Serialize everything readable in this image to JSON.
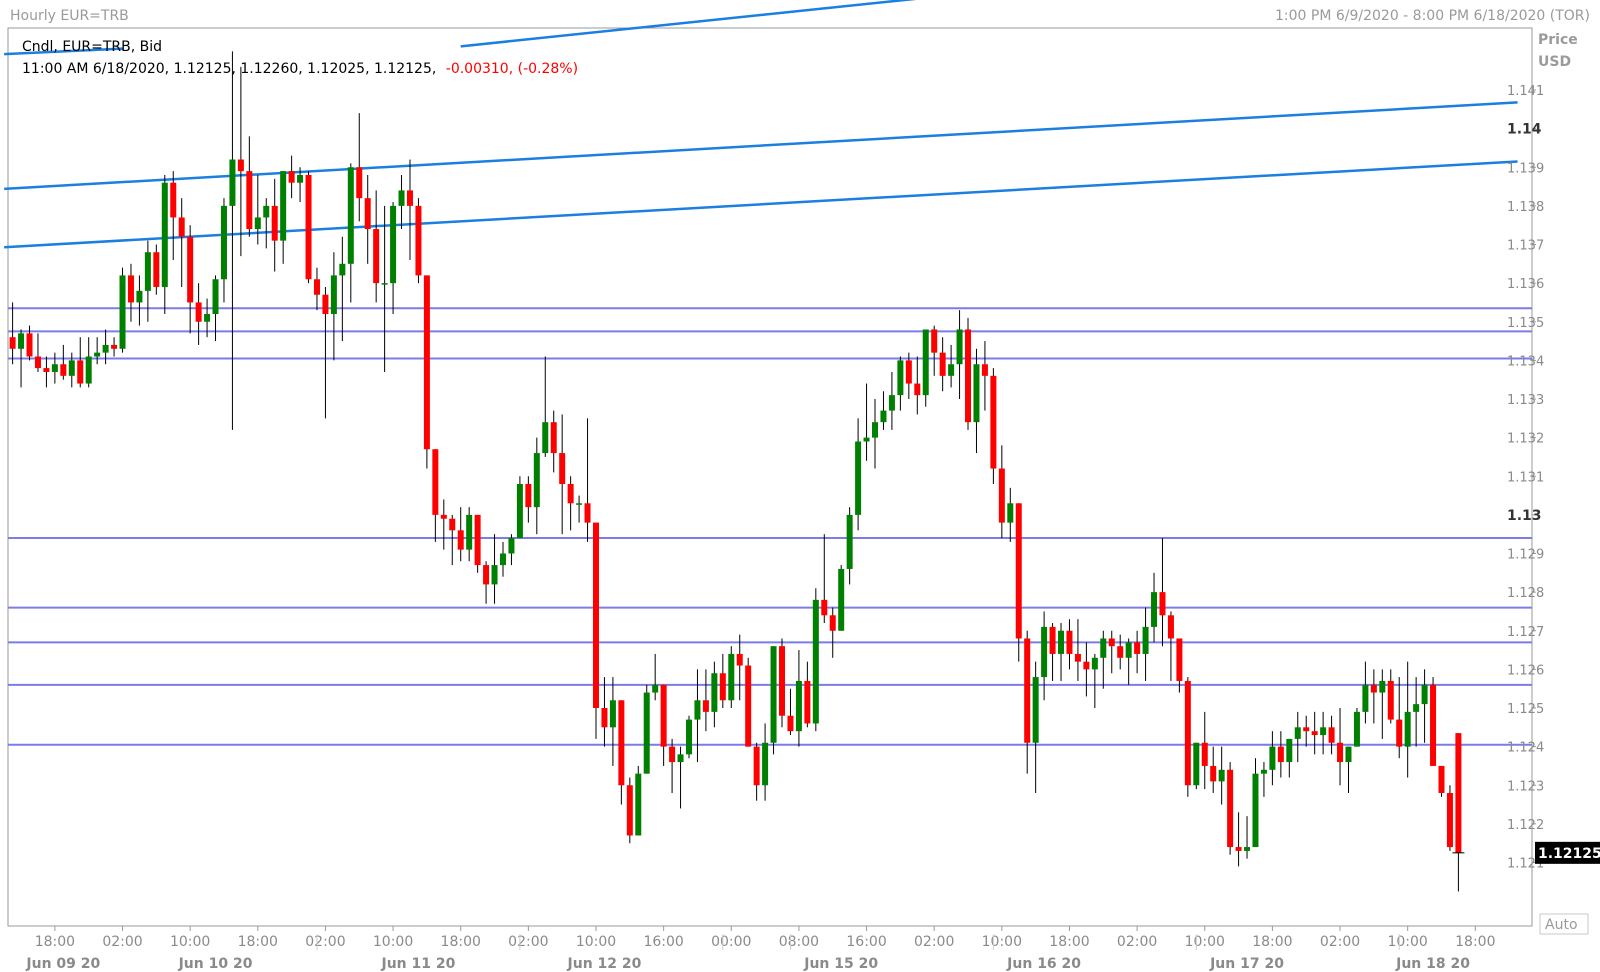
{
  "header": {
    "title": "Hourly EUR=TRB",
    "range": "1:00 PM 6/9/2020 - 8:00 PM 6/18/2020 (TOR)"
  },
  "legend": {
    "line1": "Cndl, EUR=TRB, Bid",
    "line2_prefix": "11:00 AM 6/18/2020, 1.12125, 1.12260, 1.12025, 1.12125,",
    "line2_change": "-0.00310, (-0.28%)"
  },
  "axis": {
    "price_label": "Price",
    "currency_label": "USD",
    "auto_label": "Auto",
    "last_price": "1.12125"
  },
  "colors": {
    "up": "#008000",
    "down": "#ff0000",
    "trendline": "#1a7fe0",
    "hline": "#7b7bea",
    "last_price_bg": "#000000"
  },
  "chart_data": {
    "type": "candlestick",
    "symbol": "EUR=TRB",
    "ylim": [
      1.1206,
      1.1443
    ],
    "y_ticks": [
      {
        "v": 1.141,
        "label": "1.141",
        "bold": false
      },
      {
        "v": 1.14,
        "label": "1.14",
        "bold": true
      },
      {
        "v": 1.139,
        "label": "1.139",
        "bold": false
      },
      {
        "v": 1.138,
        "label": "1.138",
        "bold": false
      },
      {
        "v": 1.137,
        "label": "1.137",
        "bold": false
      },
      {
        "v": 1.136,
        "label": "1.136",
        "bold": false
      },
      {
        "v": 1.135,
        "label": "1.135",
        "bold": false
      },
      {
        "v": 1.134,
        "label": "1.134",
        "bold": false
      },
      {
        "v": 1.133,
        "label": "1.133",
        "bold": false
      },
      {
        "v": 1.132,
        "label": "1.132",
        "bold": false
      },
      {
        "v": 1.131,
        "label": "1.131",
        "bold": false
      },
      {
        "v": 1.13,
        "label": "1.13",
        "bold": true
      },
      {
        "v": 1.129,
        "label": "1.129",
        "bold": false
      },
      {
        "v": 1.128,
        "label": "1.128",
        "bold": false
      },
      {
        "v": 1.127,
        "label": "1.127",
        "bold": false
      },
      {
        "v": 1.126,
        "label": "1.126",
        "bold": false
      },
      {
        "v": 1.125,
        "label": "1.125",
        "bold": false
      },
      {
        "v": 1.124,
        "label": "1.124",
        "bold": false
      },
      {
        "v": 1.123,
        "label": "1.123",
        "bold": false
      },
      {
        "v": 1.122,
        "label": "1.122",
        "bold": false
      },
      {
        "v": 1.121,
        "label": "1.121",
        "bold": false
      }
    ],
    "x_time_ticks": [
      {
        "i": 5,
        "label": "18:00"
      },
      {
        "i": 13,
        "label": "02:00"
      },
      {
        "i": 21,
        "label": "10:00"
      },
      {
        "i": 29,
        "label": "18:00"
      },
      {
        "i": 37,
        "label": "02:00"
      },
      {
        "i": 45,
        "label": "10:00"
      },
      {
        "i": 53,
        "label": "18:00"
      },
      {
        "i": 61,
        "label": "02:00"
      },
      {
        "i": 69,
        "label": "10:00"
      },
      {
        "i": 77,
        "label": "16:00"
      },
      {
        "i": 85,
        "label": "00:00"
      },
      {
        "i": 93,
        "label": "08:00"
      },
      {
        "i": 101,
        "label": "16:00"
      },
      {
        "i": 109,
        "label": "02:00"
      },
      {
        "i": 117,
        "label": "10:00"
      },
      {
        "i": 125,
        "label": "18:00"
      },
      {
        "i": 133,
        "label": "02:00"
      },
      {
        "i": 141,
        "label": "10:00"
      },
      {
        "i": 149,
        "label": "18:00"
      },
      {
        "i": 157,
        "label": "02:00"
      },
      {
        "i": 165,
        "label": "10:00"
      },
      {
        "i": 173,
        "label": "18:00"
      }
    ],
    "x_date_labels": [
      {
        "i": 6,
        "label": "Jun 09 20"
      },
      {
        "i": 24,
        "label": "Jun 10 20"
      },
      {
        "i": 48,
        "label": "Jun 11 20"
      },
      {
        "i": 70,
        "label": "Jun 12 20"
      },
      {
        "i": 98,
        "label": "Jun 15 20"
      },
      {
        "i": 122,
        "label": "Jun 16 20"
      },
      {
        "i": 146,
        "label": "Jun 17 20"
      },
      {
        "i": 168,
        "label": "Jun 18 20"
      }
    ],
    "date_separators": [
      36,
      60,
      84,
      92,
      116,
      140,
      164
    ],
    "horizontal_lines": [
      1.13535,
      1.13475,
      1.13405,
      1.1294,
      1.1276,
      1.1267,
      1.1256,
      1.12405
    ],
    "trendlines": [
      {
        "x1": -1,
        "y1": 1.14193,
        "x2": 13,
        "y2": 1.14207
      },
      {
        "x1": 53,
        "y1": 1.14213,
        "x2": 116,
        "y2": 1.14357
      },
      {
        "x1": -1,
        "y1": 1.13844,
        "x2": 178,
        "y2": 1.14068
      },
      {
        "x1": -1,
        "y1": 1.13693,
        "x2": 178,
        "y2": 1.13915
      }
    ],
    "candles": [
      [
        1.1346,
        1.1355,
        1.1339,
        1.1343
      ],
      [
        1.1343,
        1.1348,
        1.1333,
        1.1347
      ],
      [
        1.1347,
        1.1349,
        1.134,
        1.1341
      ],
      [
        1.1341,
        1.1347,
        1.1337,
        1.1338
      ],
      [
        1.1338,
        1.1341,
        1.1333,
        1.1337
      ],
      [
        1.1337,
        1.1342,
        1.1334,
        1.1339
      ],
      [
        1.1339,
        1.1344,
        1.1335,
        1.1336
      ],
      [
        1.1336,
        1.1342,
        1.1333,
        1.134
      ],
      [
        1.134,
        1.1346,
        1.1333,
        1.1334
      ],
      [
        1.1334,
        1.1346,
        1.1333,
        1.1341
      ],
      [
        1.1341,
        1.1346,
        1.1339,
        1.1342
      ],
      [
        1.1342,
        1.1348,
        1.1339,
        1.1344
      ],
      [
        1.1344,
        1.1346,
        1.1341,
        1.1343
      ],
      [
        1.1343,
        1.1364,
        1.1342,
        1.1362
      ],
      [
        1.1362,
        1.1365,
        1.135,
        1.1355
      ],
      [
        1.1355,
        1.1362,
        1.1349,
        1.1358
      ],
      [
        1.1358,
        1.1371,
        1.135,
        1.1368
      ],
      [
        1.1368,
        1.137,
        1.1357,
        1.1359
      ],
      [
        1.1359,
        1.1388,
        1.1352,
        1.1386
      ],
      [
        1.1386,
        1.1389,
        1.1366,
        1.1377
      ],
      [
        1.1377,
        1.1382,
        1.1359,
        1.1372
      ],
      [
        1.1372,
        1.1375,
        1.1347,
        1.1355
      ],
      [
        1.1355,
        1.136,
        1.1344,
        1.135
      ],
      [
        1.135,
        1.1356,
        1.1346,
        1.1352
      ],
      [
        1.1352,
        1.1362,
        1.1345,
        1.1361
      ],
      [
        1.1361,
        1.1382,
        1.1355,
        1.138
      ],
      [
        1.138,
        1.142,
        1.1322,
        1.1392
      ],
      [
        1.1392,
        1.1416,
        1.1367,
        1.1389
      ],
      [
        1.1389,
        1.1398,
        1.1372,
        1.1374
      ],
      [
        1.1374,
        1.1388,
        1.137,
        1.1377
      ],
      [
        1.1377,
        1.1382,
        1.1369,
        1.138
      ],
      [
        1.138,
        1.1387,
        1.1363,
        1.1371
      ],
      [
        1.1371,
        1.1386,
        1.1365,
        1.1389
      ],
      [
        1.1389,
        1.1393,
        1.1382,
        1.1386
      ],
      [
        1.1386,
        1.139,
        1.1381,
        1.1388
      ],
      [
        1.1388,
        1.1389,
        1.136,
        1.1361
      ],
      [
        1.1361,
        1.1364,
        1.1353,
        1.1357
      ],
      [
        1.1357,
        1.1359,
        1.1325,
        1.1352
      ],
      [
        1.1352,
        1.1368,
        1.134,
        1.1362
      ],
      [
        1.1362,
        1.1372,
        1.1345,
        1.1365
      ],
      [
        1.1365,
        1.1391,
        1.1355,
        1.139
      ],
      [
        1.139,
        1.1404,
        1.1376,
        1.1382
      ],
      [
        1.1382,
        1.1388,
        1.1365,
        1.1374
      ],
      [
        1.1374,
        1.1384,
        1.1355,
        1.136
      ],
      [
        1.136,
        1.138,
        1.1337,
        1.136
      ],
      [
        1.136,
        1.1381,
        1.1352,
        1.138
      ],
      [
        1.138,
        1.1388,
        1.1374,
        1.1384
      ],
      [
        1.1384,
        1.1392,
        1.1366,
        1.138
      ],
      [
        1.138,
        1.1382,
        1.136,
        1.1362
      ],
      [
        1.1362,
        1.1362,
        1.1312,
        1.1317
      ],
      [
        1.1317,
        1.1317,
        1.1293,
        1.13
      ],
      [
        1.13,
        1.1304,
        1.1291,
        1.1299
      ],
      [
        1.1299,
        1.13,
        1.1287,
        1.1296
      ],
      [
        1.1296,
        1.1302,
        1.1288,
        1.1291
      ],
      [
        1.1291,
        1.1302,
        1.1288,
        1.13
      ],
      [
        1.13,
        1.13,
        1.1285,
        1.1287
      ],
      [
        1.1287,
        1.1288,
        1.1277,
        1.1282
      ],
      [
        1.1282,
        1.1295,
        1.1277,
        1.1287
      ],
      [
        1.1287,
        1.1293,
        1.1284,
        1.129
      ],
      [
        1.129,
        1.1295,
        1.1287,
        1.1294
      ],
      [
        1.1294,
        1.131,
        1.1294,
        1.1308
      ],
      [
        1.1308,
        1.131,
        1.1298,
        1.1302
      ],
      [
        1.1302,
        1.132,
        1.1295,
        1.1316
      ],
      [
        1.1316,
        1.1341,
        1.1315,
        1.1324
      ],
      [
        1.1324,
        1.1327,
        1.1311,
        1.1316
      ],
      [
        1.1316,
        1.1326,
        1.1295,
        1.1308
      ],
      [
        1.1308,
        1.131,
        1.1296,
        1.1303
      ],
      [
        1.1303,
        1.1305,
        1.1298,
        1.1303
      ],
      [
        1.1303,
        1.1325,
        1.1293,
        1.1298
      ],
      [
        1.1298,
        1.1298,
        1.1242,
        1.125
      ],
      [
        1.125,
        1.1258,
        1.124,
        1.1245
      ],
      [
        1.1245,
        1.1258,
        1.1235,
        1.1252
      ],
      [
        1.1252,
        1.125,
        1.1225,
        1.123
      ],
      [
        1.123,
        1.1232,
        1.1215,
        1.1217
      ],
      [
        1.1217,
        1.1235,
        1.1224,
        1.1233
      ],
      [
        1.1233,
        1.1256,
        1.1233,
        1.1254
      ],
      [
        1.1254,
        1.1264,
        1.1252,
        1.1256
      ],
      [
        1.1256,
        1.1256,
        1.1235,
        1.124
      ],
      [
        1.124,
        1.1242,
        1.1228,
        1.1236
      ],
      [
        1.1236,
        1.124,
        1.1224,
        1.1238
      ],
      [
        1.1238,
        1.1248,
        1.1237,
        1.1247
      ],
      [
        1.1247,
        1.126,
        1.1236,
        1.1252
      ],
      [
        1.1252,
        1.126,
        1.1244,
        1.1249
      ],
      [
        1.1249,
        1.1262,
        1.1245,
        1.1259
      ],
      [
        1.1259,
        1.1264,
        1.125,
        1.1252
      ],
      [
        1.1252,
        1.1266,
        1.125,
        1.1264
      ],
      [
        1.1264,
        1.1269,
        1.1252,
        1.1261
      ],
      [
        1.1261,
        1.1263,
        1.1243,
        1.124
      ],
      [
        1.124,
        1.1241,
        1.1226,
        1.123
      ],
      [
        1.123,
        1.1246,
        1.1226,
        1.1241
      ],
      [
        1.1241,
        1.1265,
        1.1238,
        1.1266
      ],
      [
        1.1266,
        1.1268,
        1.1245,
        1.1248
      ],
      [
        1.1248,
        1.1255,
        1.1243,
        1.1244
      ],
      [
        1.1244,
        1.1265,
        1.124,
        1.1257
      ],
      [
        1.1257,
        1.1262,
        1.1245,
        1.1246
      ],
      [
        1.1246,
        1.1281,
        1.1244,
        1.1278
      ],
      [
        1.1278,
        1.1295,
        1.1272,
        1.1274
      ],
      [
        1.1274,
        1.1276,
        1.1263,
        1.127
      ],
      [
        1.127,
        1.1287,
        1.127,
        1.1286
      ],
      [
        1.1286,
        1.1302,
        1.1282,
        1.13
      ],
      [
        1.13,
        1.1325,
        1.1296,
        1.1319
      ],
      [
        1.1319,
        1.1334,
        1.1314,
        1.132
      ],
      [
        1.132,
        1.133,
        1.1312,
        1.1324
      ],
      [
        1.1324,
        1.1332,
        1.1322,
        1.1327
      ],
      [
        1.1327,
        1.1337,
        1.1322,
        1.1331
      ],
      [
        1.1331,
        1.1341,
        1.1327,
        1.134
      ],
      [
        1.134,
        1.1342,
        1.133,
        1.1334
      ],
      [
        1.1334,
        1.1341,
        1.1326,
        1.1331
      ],
      [
        1.1331,
        1.1342,
        1.1328,
        1.1348
      ],
      [
        1.1348,
        1.1349,
        1.1336,
        1.1342
      ],
      [
        1.1342,
        1.1346,
        1.1332,
        1.1336
      ],
      [
        1.1336,
        1.1344,
        1.1333,
        1.1339
      ],
      [
        1.1339,
        1.1353,
        1.133,
        1.1348
      ],
      [
        1.1348,
        1.1351,
        1.1322,
        1.1324
      ],
      [
        1.1324,
        1.1343,
        1.1316,
        1.1339
      ],
      [
        1.1339,
        1.1345,
        1.1327,
        1.1336
      ],
      [
        1.1336,
        1.1338,
        1.1308,
        1.1312
      ],
      [
        1.1312,
        1.1318,
        1.1294,
        1.1298
      ],
      [
        1.1298,
        1.1307,
        1.1293,
        1.1303
      ],
      [
        1.1303,
        1.1303,
        1.1262,
        1.1268
      ],
      [
        1.1268,
        1.127,
        1.1233,
        1.1241
      ],
      [
        1.1241,
        1.1262,
        1.1228,
        1.1258
      ],
      [
        1.1258,
        1.1275,
        1.1252,
        1.1271
      ],
      [
        1.1271,
        1.1272,
        1.1257,
        1.1264
      ],
      [
        1.1264,
        1.1272,
        1.1257,
        1.127
      ],
      [
        1.127,
        1.1273,
        1.126,
        1.1264
      ],
      [
        1.1264,
        1.1273,
        1.1257,
        1.1262
      ],
      [
        1.1262,
        1.1267,
        1.1253,
        1.126
      ],
      [
        1.126,
        1.1264,
        1.125,
        1.1263
      ],
      [
        1.1263,
        1.127,
        1.1255,
        1.1268
      ],
      [
        1.1268,
        1.127,
        1.1259,
        1.1266
      ],
      [
        1.1266,
        1.1269,
        1.126,
        1.1263
      ],
      [
        1.1263,
        1.1268,
        1.1256,
        1.1267
      ],
      [
        1.1267,
        1.127,
        1.1259,
        1.1264
      ],
      [
        1.1264,
        1.1276,
        1.1257,
        1.1271
      ],
      [
        1.1271,
        1.1285,
        1.1267,
        1.128
      ],
      [
        1.128,
        1.1294,
        1.1266,
        1.1274
      ],
      [
        1.1274,
        1.1275,
        1.1257,
        1.1268
      ],
      [
        1.1268,
        1.1268,
        1.1254,
        1.1257
      ],
      [
        1.1257,
        1.1258,
        1.1227,
        1.123
      ],
      [
        1.123,
        1.124,
        1.1229,
        1.1241
      ],
      [
        1.1241,
        1.1249,
        1.1229,
        1.1235
      ],
      [
        1.1235,
        1.124,
        1.1228,
        1.1231
      ],
      [
        1.1231,
        1.124,
        1.1225,
        1.1234
      ],
      [
        1.1234,
        1.1236,
        1.1212,
        1.1214
      ],
      [
        1.1214,
        1.1223,
        1.1209,
        1.1213
      ],
      [
        1.1213,
        1.1222,
        1.1211,
        1.1214
      ],
      [
        1.1214,
        1.1237,
        1.1214,
        1.1233
      ],
      [
        1.1233,
        1.1236,
        1.1227,
        1.1234
      ],
      [
        1.1234,
        1.1244,
        1.123,
        1.124
      ],
      [
        1.124,
        1.1244,
        1.1232,
        1.1236
      ],
      [
        1.1236,
        1.1242,
        1.1232,
        1.1242
      ],
      [
        1.1242,
        1.1249,
        1.1236,
        1.1245
      ],
      [
        1.1245,
        1.1248,
        1.124,
        1.1244
      ],
      [
        1.1244,
        1.1249,
        1.1238,
        1.1243
      ],
      [
        1.1243,
        1.1249,
        1.1238,
        1.1245
      ],
      [
        1.1245,
        1.1248,
        1.1238,
        1.1241
      ],
      [
        1.1241,
        1.125,
        1.123,
        1.1236
      ],
      [
        1.1236,
        1.124,
        1.1228,
        1.124
      ],
      [
        1.124,
        1.125,
        1.124,
        1.1249
      ],
      [
        1.1249,
        1.1262,
        1.1246,
        1.1256
      ],
      [
        1.1256,
        1.126,
        1.1246,
        1.1254
      ],
      [
        1.1254,
        1.126,
        1.1242,
        1.1257
      ],
      [
        1.1257,
        1.126,
        1.1246,
        1.1247
      ],
      [
        1.1247,
        1.1258,
        1.1237,
        1.124
      ],
      [
        1.124,
        1.1262,
        1.1232,
        1.1249
      ],
      [
        1.1249,
        1.1258,
        1.124,
        1.1251
      ],
      [
        1.1251,
        1.126,
        1.1241,
        1.1256
      ],
      [
        1.1256,
        1.1258,
        1.1236,
        1.1235
      ],
      [
        1.1235,
        1.1232,
        1.1227,
        1.1228
      ],
      [
        1.1228,
        1.123,
        1.1213,
        1.1214
      ],
      [
        1.12435,
        1.1226,
        1.12025,
        1.12125
      ]
    ]
  }
}
